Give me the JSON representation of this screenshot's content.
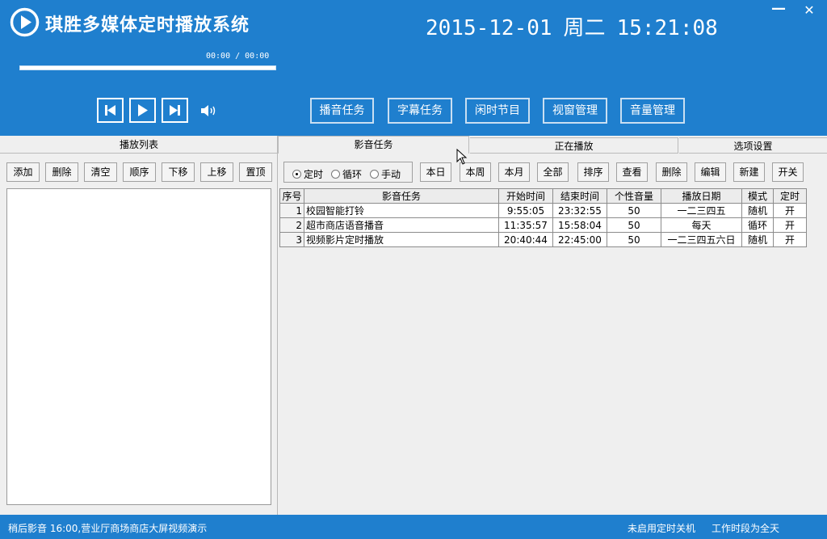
{
  "header": {
    "app_title": "琪胜多媒体定时播放系统",
    "date": "2015-12-01",
    "weekday": "周二",
    "time": "15:21:08",
    "minimize_label": "—",
    "close_label": "✕",
    "time_readout": "00:00 / 00:00",
    "progress_fraction": 0,
    "logo_icon": "play-circle-icon"
  },
  "transport": {
    "prev_icon": "skip-previous-icon",
    "play_icon": "play-icon",
    "next_icon": "skip-next-icon",
    "volume_icon": "volume-icon"
  },
  "menu": {
    "broadcast_tasks": "播音任务",
    "subtitle_tasks": "字幕任务",
    "idle_programs": "闲时节目",
    "window_management": "视窗管理",
    "volume_management": "音量管理"
  },
  "playlist": {
    "tab_label": "播放列表",
    "buttons": [
      "添加",
      "删除",
      "清空",
      "顺序",
      "下移",
      "上移",
      "置顶"
    ]
  },
  "tabs": {
    "media_tasks": "影音任务",
    "now_playing": "正在播放",
    "options": "选项设置"
  },
  "mode": {
    "timed": "定时",
    "loop": "循环",
    "manual": "手动",
    "selected": "定时"
  },
  "toolbar": {
    "today": "本日",
    "this_week": "本周",
    "this_month": "本月",
    "all": "全部",
    "sort": "排序",
    "view": "查看",
    "delete": "删除",
    "edit": "编辑",
    "new": "新建",
    "toggle": "开关"
  },
  "table": {
    "headers": [
      "序号",
      "影音任务",
      "开始时间",
      "结束时间",
      "个性音量",
      "播放日期",
      "模式",
      "定时"
    ],
    "rows": [
      [
        "1",
        "校园智能打铃",
        "9:55:05",
        "23:32:55",
        "50",
        "一二三四五",
        "随机",
        "开"
      ],
      [
        "2",
        "超市商店语音播音",
        "11:35:57",
        "15:58:04",
        "50",
        "每天",
        "循环",
        "开"
      ],
      [
        "3",
        "视频影片定时播放",
        "20:40:44",
        "22:45:00",
        "50",
        "一二三四五六日",
        "随机",
        "开"
      ]
    ]
  },
  "status": {
    "next_item": "稍后影音 16:00,营业厅商场商店大屏视频演示",
    "shutdown": "未启用定时关机",
    "work_period": "工作时段为全天"
  },
  "colors": {
    "brand_blue": "#1f7fce",
    "panel_gray": "#efefef"
  }
}
